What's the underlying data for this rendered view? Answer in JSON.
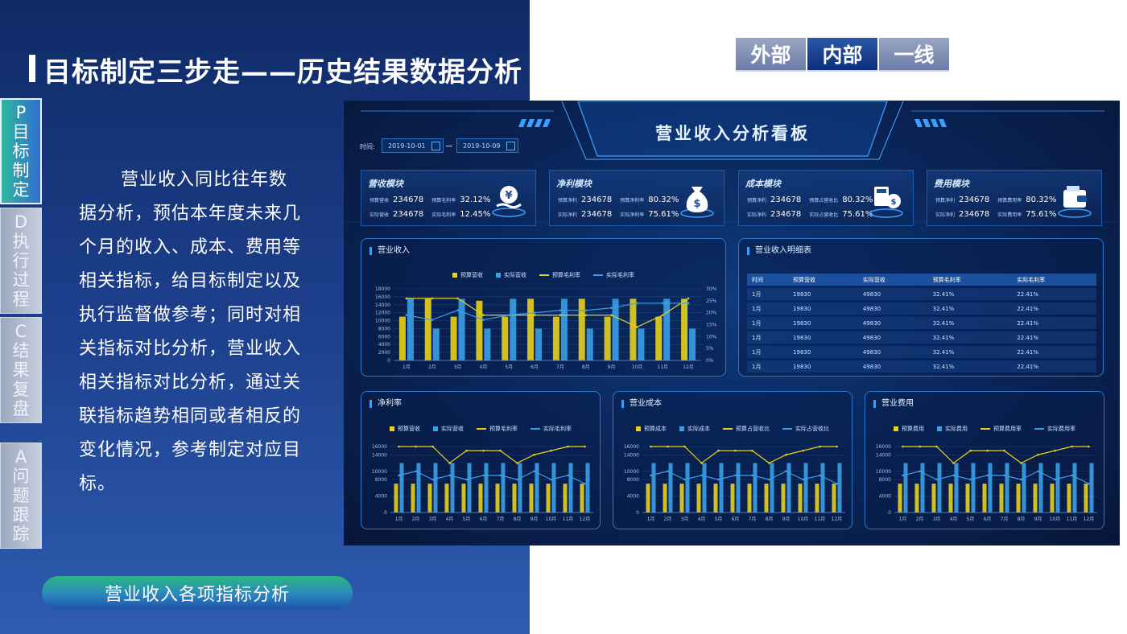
{
  "slide": {
    "title": "目标制定三步走——历史结果数据分析",
    "pdca": [
      {
        "letter": "P",
        "chars": [
          "目",
          "标",
          "制",
          "定"
        ],
        "active": true
      },
      {
        "letter": "D",
        "chars": [
          "执",
          "行",
          "过",
          "程"
        ],
        "active": false
      },
      {
        "letter": "C",
        "chars": [
          "结",
          "果",
          "复",
          "盘"
        ],
        "active": false
      },
      {
        "letter": "A",
        "chars": [
          "问",
          "题",
          "跟",
          "踪"
        ],
        "active": false
      }
    ],
    "description": "营业收入同比往年数据分析，预估本年度未来几个月的收入、成本、费用等相关指标，给目标制定以及执行监督做参考；同时对相关指标对比分析，营业收入相关指标对比分析，通过关联指标趋势相同或者相反的变化情况，参考制定对应目标。",
    "pill_label": "营业收入各项指标分析",
    "tabs": [
      "外部",
      "内部",
      "一线"
    ],
    "active_tab": 1
  },
  "dashboard": {
    "title": "营业收入分析看板",
    "time_label": "时间:",
    "date_start": "2019-10-01",
    "date_sep": "—",
    "date_end": "2019-10-09",
    "kpis": [
      {
        "title": "营收模块",
        "r1l": "预算营收",
        "r1v": "234678",
        "r1l2": "预算毛利率",
        "r1v2": "32.12%",
        "r2l": "实际营收",
        "r2v": "234678",
        "r2l2": "实际毛利率",
        "r2v2": "12.45%",
        "icon": "money-hand-icon"
      },
      {
        "title": "净利模块",
        "r1l": "预算净利",
        "r1v": "234678",
        "r1l2": "预算净利率",
        "r1v2": "80.32%",
        "r2l": "实际净利",
        "r2v": "234678",
        "r2l2": "实际净利率",
        "r2v2": "75.61%",
        "icon": "money-bag-icon"
      },
      {
        "title": "成本模块",
        "r1l": "预算净利",
        "r1v": "234678",
        "r1l2": "预算占营收比",
        "r1v2": "80.32%",
        "r2l": "实际净利",
        "r2v": "234678",
        "r2l2": "实际占营收比",
        "r2v2": "75.61%",
        "icon": "calculator-coin-icon"
      },
      {
        "title": "费用模块",
        "r1l": "预算净利",
        "r1v": "234678",
        "r1l2": "预算费用率",
        "r1v2": "80.32%",
        "r2l": "实际净利",
        "r2v": "234678",
        "r2l2": "实际费用率",
        "r2v2": "75.61%",
        "icon": "wallet-icon"
      }
    ],
    "table": {
      "title": "营业收入明细表",
      "headers": [
        "时间",
        "预算营收",
        "实际营收",
        "预算毛利率",
        "实际毛利率"
      ],
      "rows": [
        [
          "1月",
          "19830",
          "49830",
          "32.41%",
          "22.41%"
        ],
        [
          "1月",
          "19830",
          "49830",
          "32.41%",
          "22.41%"
        ],
        [
          "1月",
          "19830",
          "49830",
          "32.41%",
          "22.41%"
        ],
        [
          "1月",
          "19830",
          "49830",
          "32.41%",
          "22.41%"
        ],
        [
          "1月",
          "19830",
          "49830",
          "32.41%",
          "22.41%"
        ],
        [
          "1月",
          "19830",
          "49830",
          "32.41%",
          "22.41%"
        ]
      ]
    }
  },
  "chart_data": [
    {
      "type": "bar",
      "title": "营业收入",
      "categories": [
        "1月",
        "2月",
        "3月",
        "4月",
        "5月",
        "6月",
        "7月",
        "8月",
        "9月",
        "10月",
        "11月",
        "12月"
      ],
      "ylim": [
        0,
        18000
      ],
      "yticks": [
        0,
        2000,
        4000,
        6000,
        8000,
        10000,
        12000,
        14000,
        16000,
        18000
      ],
      "y2lim": [
        0,
        30
      ],
      "y2ticks": [
        "0%",
        "5%",
        "10%",
        "15%",
        "20%",
        "25%",
        "30%"
      ],
      "series": [
        {
          "name": "预算营收",
          "kind": "bar",
          "color": "#e8d21c",
          "values": [
            11000,
            15500,
            11000,
            15000,
            11000,
            15500,
            11000,
            15500,
            11000,
            15500,
            11000,
            15500
          ]
        },
        {
          "name": "实际营收",
          "kind": "bar",
          "color": "#3aa0e6",
          "values": [
            15500,
            8000,
            15500,
            8000,
            15500,
            8000,
            15500,
            8000,
            15500,
            8000,
            15500,
            8000
          ]
        },
        {
          "name": "预算毛利率",
          "kind": "line",
          "color": "#e8d21c",
          "axis": "right",
          "values": [
            26,
            26,
            26,
            19,
            19,
            19,
            19,
            19,
            19,
            14,
            19,
            26
          ]
        },
        {
          "name": "实际毛利率",
          "kind": "line",
          "color": "#3aa0e6",
          "axis": "right",
          "values": [
            19,
            17,
            21,
            17,
            19,
            20,
            21,
            21,
            22,
            24,
            24,
            24
          ]
        }
      ]
    },
    {
      "type": "bar",
      "title": "净利率",
      "categories": [
        "1月",
        "2月",
        "3月",
        "4月",
        "5月",
        "6月",
        "7月",
        "8月",
        "9月",
        "10月",
        "11月",
        "12月"
      ],
      "ylim": [
        0,
        16000
      ],
      "yticks": [
        0,
        4000,
        8000,
        10000,
        14000,
        16000
      ],
      "series": [
        {
          "name": "预算营收",
          "kind": "bar",
          "color": "#e8d21c",
          "values": [
            7000,
            7000,
            7000,
            7000,
            7000,
            7000,
            7000,
            7000,
            7000,
            7000,
            7000,
            7000
          ]
        },
        {
          "name": "实际营收",
          "kind": "bar",
          "color": "#3aa0e6",
          "values": [
            12000,
            12000,
            12000,
            12000,
            12000,
            12000,
            12000,
            12000,
            12000,
            12000,
            12000,
            12000
          ]
        },
        {
          "name": "预算毛利率",
          "kind": "line",
          "color": "#e8d21c",
          "values": [
            16000,
            16000,
            16000,
            12000,
            15000,
            15000,
            15000,
            12000,
            14000,
            15000,
            16000,
            16000
          ]
        },
        {
          "name": "实际毛利率",
          "kind": "line",
          "color": "#3aa0e6",
          "values": [
            9000,
            10000,
            8000,
            9000,
            8000,
            9000,
            9000,
            8000,
            10000,
            8000,
            9000,
            7000
          ]
        }
      ]
    },
    {
      "type": "bar",
      "title": "营业成本",
      "categories": [
        "1月",
        "2月",
        "3月",
        "4月",
        "5月",
        "6月",
        "7月",
        "8月",
        "9月",
        "10月",
        "11月",
        "12月"
      ],
      "ylim": [
        0,
        16000
      ],
      "yticks": [
        0,
        4000,
        8000,
        10000,
        14000,
        16000
      ],
      "series": [
        {
          "name": "预算成本",
          "kind": "bar",
          "color": "#e8d21c",
          "values": [
            7000,
            7000,
            7000,
            7000,
            7000,
            7000,
            7000,
            7000,
            7000,
            7000,
            7000,
            7000
          ]
        },
        {
          "name": "实际成本",
          "kind": "bar",
          "color": "#3aa0e6",
          "values": [
            12000,
            12000,
            12000,
            12000,
            12000,
            12000,
            12000,
            12000,
            12000,
            12000,
            12000,
            12000
          ]
        },
        {
          "name": "预算占营收比",
          "kind": "line",
          "color": "#e8d21c",
          "values": [
            16000,
            16000,
            16000,
            12000,
            15000,
            15000,
            15000,
            12000,
            14000,
            15000,
            16000,
            16000
          ]
        },
        {
          "name": "实际占营收比",
          "kind": "line",
          "color": "#3aa0e6",
          "values": [
            9000,
            10000,
            8000,
            9000,
            8000,
            9000,
            9000,
            8000,
            10000,
            8000,
            9000,
            7000
          ]
        }
      ]
    },
    {
      "type": "bar",
      "title": "营业费用",
      "categories": [
        "1月",
        "2月",
        "3月",
        "4月",
        "5月",
        "6月",
        "7月",
        "8月",
        "9月",
        "10月",
        "11月",
        "12月"
      ],
      "ylim": [
        0,
        16000
      ],
      "yticks": [
        0,
        4000,
        8000,
        10000,
        14000,
        16000
      ],
      "series": [
        {
          "name": "预算费用",
          "kind": "bar",
          "color": "#e8d21c",
          "values": [
            7000,
            7000,
            7000,
            7000,
            7000,
            7000,
            7000,
            7000,
            7000,
            7000,
            7000,
            7000
          ]
        },
        {
          "name": "实际费用",
          "kind": "bar",
          "color": "#3aa0e6",
          "values": [
            12000,
            12000,
            12000,
            12000,
            12000,
            12000,
            12000,
            12000,
            12000,
            12000,
            12000,
            12000
          ]
        },
        {
          "name": "预算费用率",
          "kind": "line",
          "color": "#e8d21c",
          "values": [
            16000,
            16000,
            16000,
            12000,
            15000,
            15000,
            15000,
            12000,
            14000,
            15000,
            16000,
            16000
          ]
        },
        {
          "name": "实际费用率",
          "kind": "line",
          "color": "#3aa0e6",
          "values": [
            9000,
            10000,
            8000,
            9000,
            8000,
            9000,
            9000,
            8000,
            10000,
            8000,
            9000,
            7000
          ]
        }
      ]
    }
  ]
}
